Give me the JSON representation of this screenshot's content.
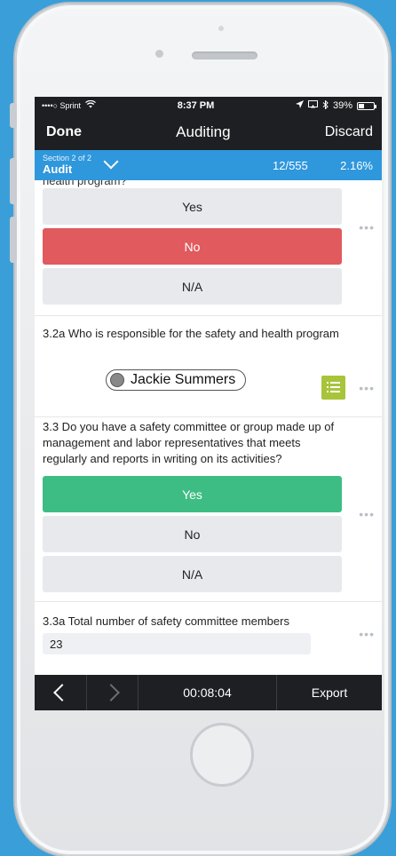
{
  "status": {
    "carrier": "••••○ Sprint",
    "time": "8:37 PM",
    "battery": "39%",
    "battery_level": 0.39
  },
  "nav": {
    "done_label": "Done",
    "title": "Auditing",
    "discard_label": "Discard"
  },
  "section": {
    "position": "Section 2 of 2",
    "name": "Audit",
    "count": "12/555",
    "percent": "2.16%"
  },
  "questions": {
    "prev_question_tail": "health program?",
    "q1_options": [
      "Yes",
      "No",
      "N/A"
    ],
    "q1_selected": "No",
    "q2_text": "3.2a Who is responsible for the safety and health program",
    "q2_answer": "Jackie Summers",
    "q3_text": "3.3 Do you have a safety committee or group made up of management and labor representatives that meets regularly and reports in writing on its activities?",
    "q3_options": [
      "Yes",
      "No",
      "N/A"
    ],
    "q3_selected": "Yes",
    "q4_text": "3.3a Total number of safety committee members",
    "q4_value": "23",
    "more_glyph": "•••"
  },
  "bottom": {
    "timer": "00:08:04",
    "export_label": "Export"
  },
  "colors": {
    "accent_blue": "#2f97dc",
    "no_red": "#e15a5d",
    "yes_green": "#3dbd84",
    "list_icon_green": "#a8c43a"
  }
}
